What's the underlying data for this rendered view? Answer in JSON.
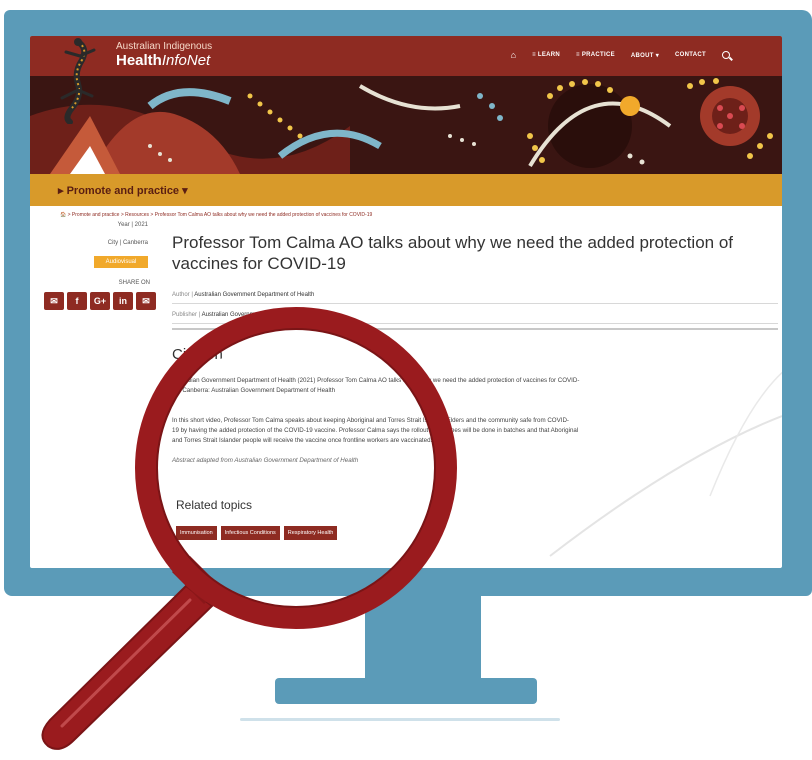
{
  "site": {
    "brand_line1": "Australian Indigenous",
    "brand_line2_a": "Health",
    "brand_line2_b": "InfoNet"
  },
  "nav": {
    "home_icon": "home-icon",
    "items": [
      "LEARN",
      "PRACTICE",
      "ABOUT ▾",
      "CONTACT"
    ],
    "learn_prefix": "≡",
    "practice_prefix": "≡",
    "search_icon": "search-icon"
  },
  "subnav": {
    "label": "▸ Promote and practice ▾"
  },
  "breadcrumb": "🏠 > Promote and practice > Resources > Professor Tom Calma AO talks about why we need the added protection of vaccines for COVID-19",
  "meta": {
    "year": "Year | 2021",
    "city": "City | Canberra",
    "badge": "Audiovisual",
    "share_label": "SHARE ON"
  },
  "share_buttons": [
    "✉",
    "f",
    "G+",
    "in",
    "✉"
  ],
  "article": {
    "title": "Professor Tom Calma AO talks about why we need the added protection of vaccines for COVID-19",
    "author_key": "Author |",
    "author_val": "Australian Government Department of Health",
    "publisher_key": "Publisher |",
    "publisher_val": "Australian Government Department of Health",
    "citation_heading": "Citation",
    "citation_line1": "Australian Government Department of Health (2021) Professor Tom Calma AO talks about why we need the added protection of vaccines for COVID-",
    "citation_line2": "19. Canberra: Australian Government Department of Health",
    "abstract_line1": "In this short video, Professor Tom Calma speaks about keeping Aboriginal and Torres Strait Islander Elders and the community safe from COVID-",
    "abstract_line2": "19 by having the added protection of the COVID-19 vaccine. Professor Calma says the rollout of vaccines will be done in batches and that Aboriginal",
    "abstract_line3": "and Torres Strait Islander people will receive the vaccine once frontline workers are vaccinated.",
    "abstract_source": "Abstract adapted from Australian Government Department of Health"
  },
  "related": {
    "heading": "Related topics",
    "tags": [
      "Immunisation",
      "Infectious Conditions",
      "Respiratory Health"
    ]
  },
  "colors": {
    "monitor": "#5b9bb8",
    "header": "#8e2b22",
    "subnav": "#d89a2a",
    "badge": "#f1a92b",
    "magnifier": "#9a1b1e"
  }
}
